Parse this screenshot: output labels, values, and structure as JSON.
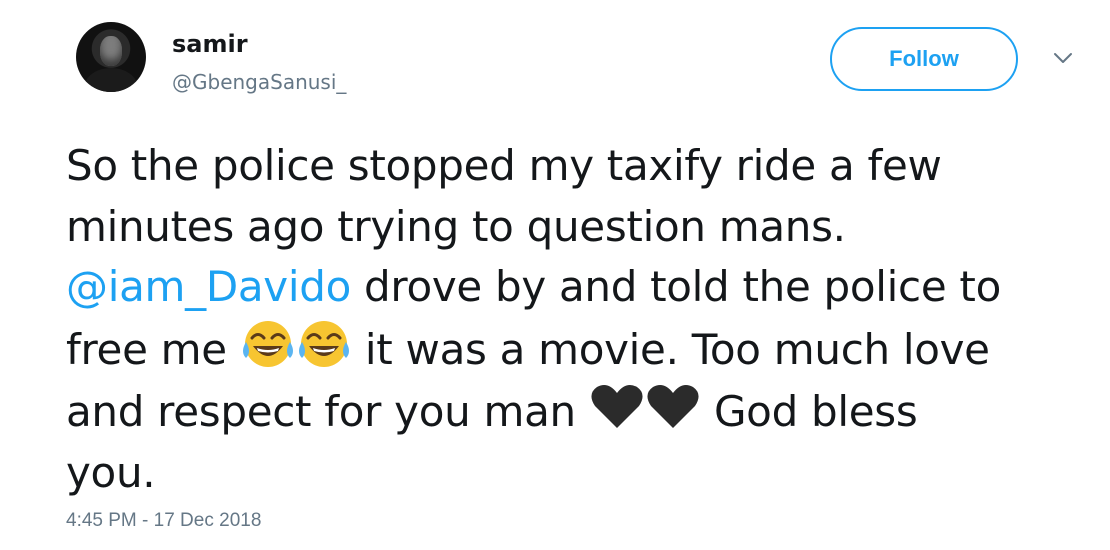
{
  "user": {
    "name": "samir",
    "handle": "@GbengaSanusi_"
  },
  "follow_label": "Follow",
  "tweet": {
    "line1": "So the police stopped my taxify ride a few",
    "line2": "minutes ago trying to question mans.",
    "mention": "@iam_Davido",
    "line3_rest": " drove by and told the police to",
    "line4_a": "free me ",
    "line4_b": " it was a movie. Too much love",
    "line5_a": "and respect for you man ",
    "line5_b": " God bless",
    "line6": "you."
  },
  "emojis": [
    "face-with-tears-of-joy-icon",
    "face-with-tears-of-joy-icon",
    "black-heart-icon",
    "black-heart-icon"
  ],
  "timestamp": "4:45 PM - 17 Dec 2018",
  "colors": {
    "accent": "#1da1f2",
    "text": "#14171a",
    "secondary": "#657786"
  }
}
